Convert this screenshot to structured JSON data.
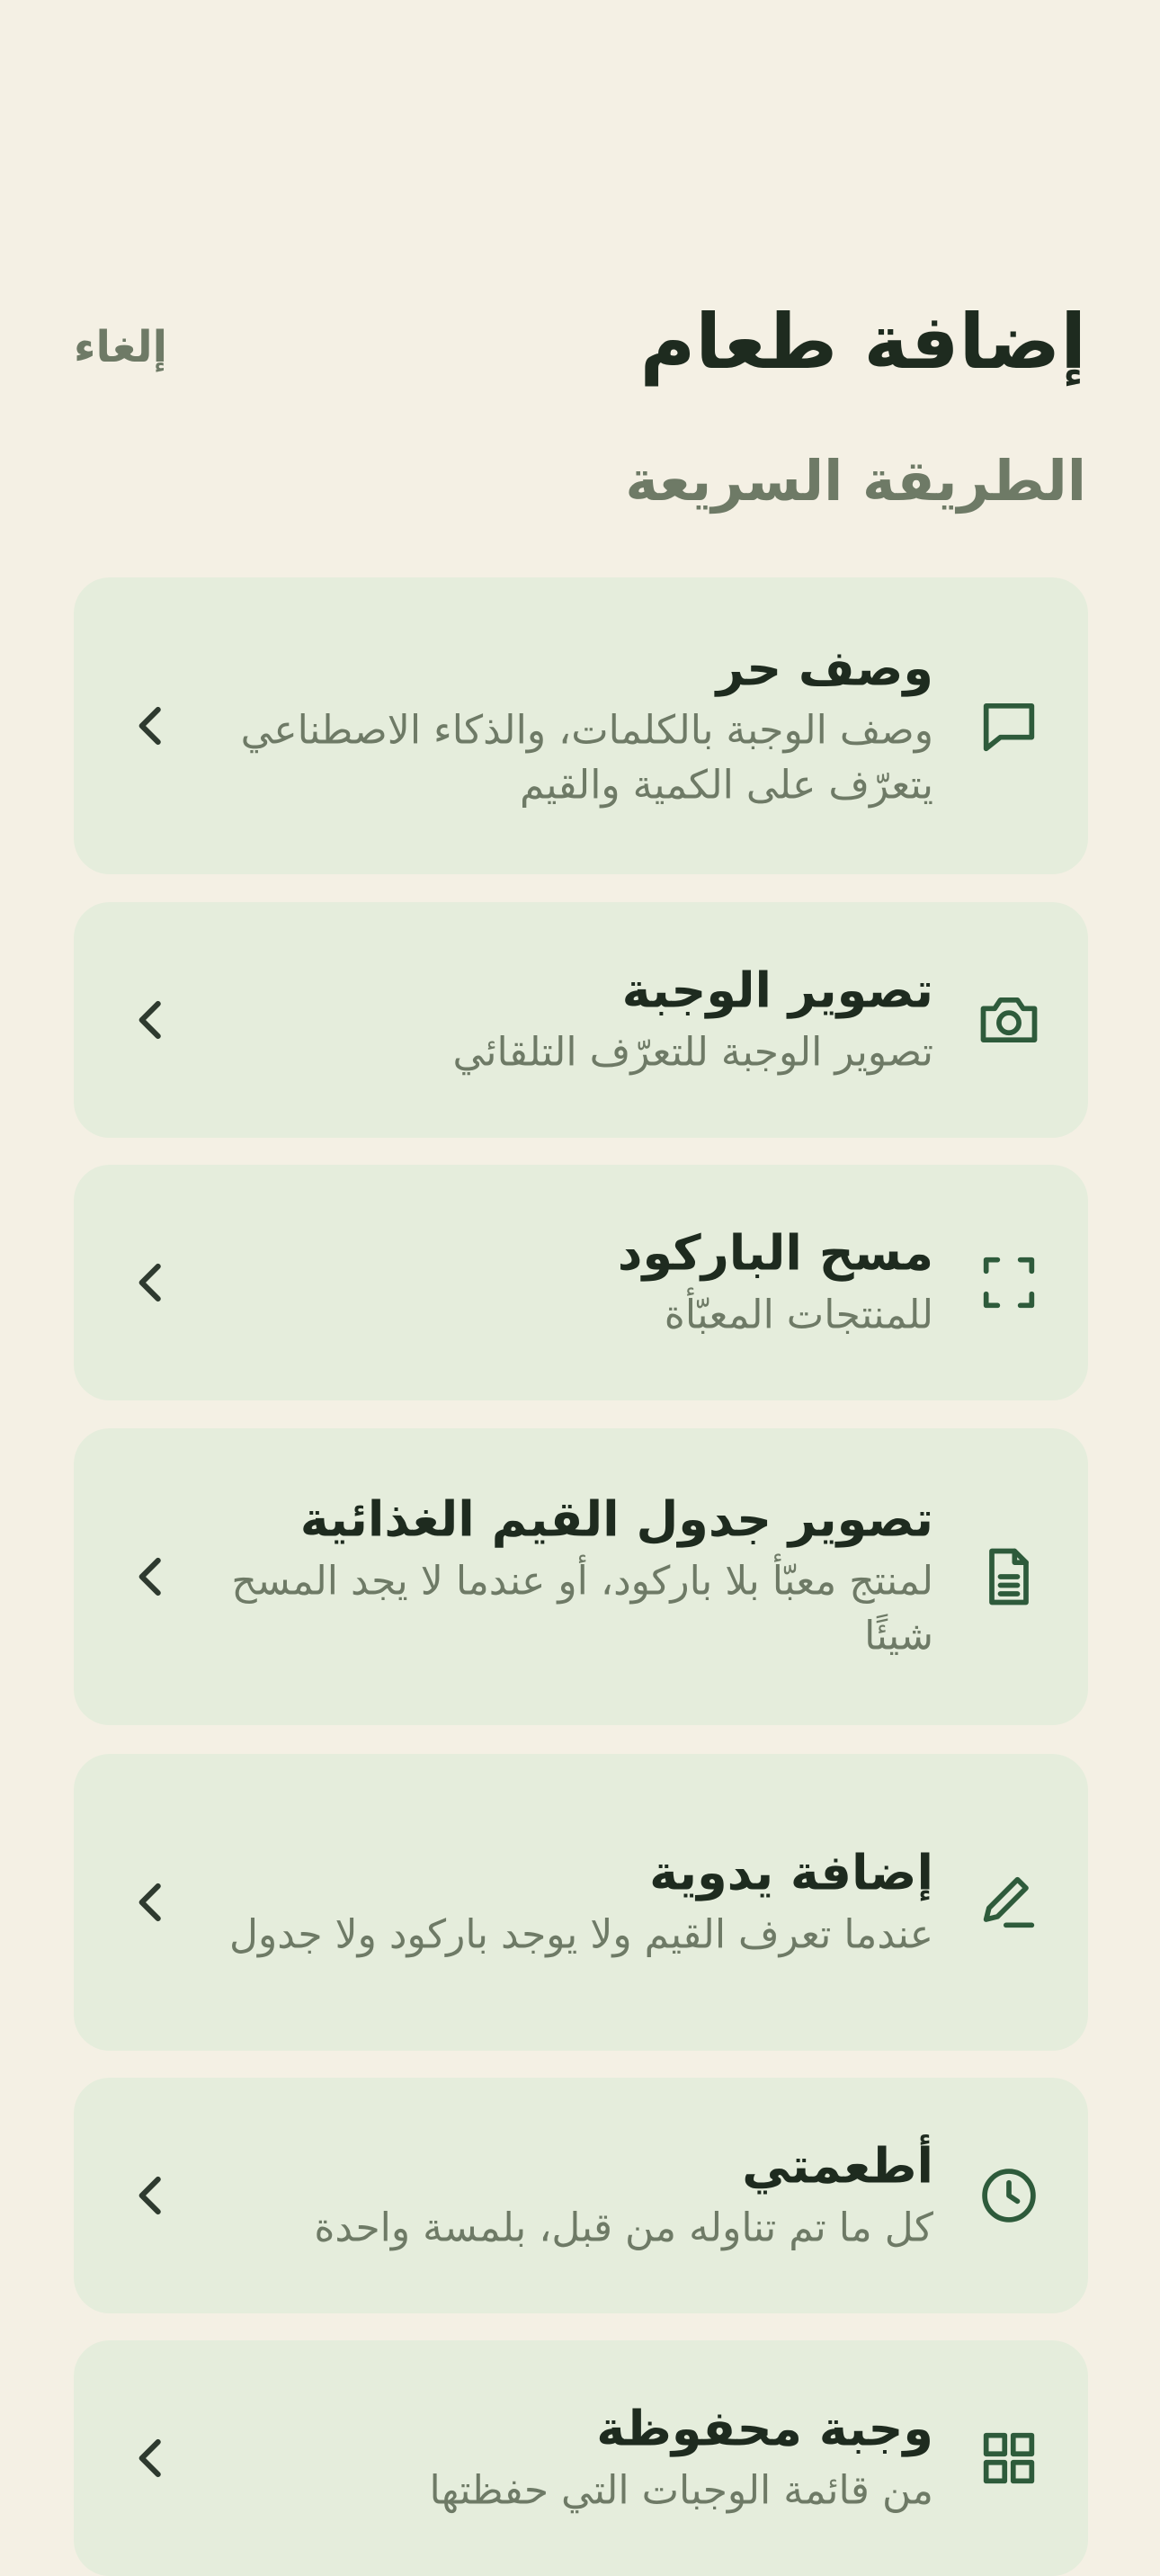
{
  "header": {
    "title": "إضافة طعام",
    "cancel_label": "إلغاء"
  },
  "section_title": "الطريقة السريعة",
  "colors": {
    "background": "#F4F0E4",
    "card": "#E5EDDC",
    "icon": "#2E5B3B",
    "title_text": "#1E2B1F",
    "secondary_text": "#6E7A66"
  },
  "options": [
    {
      "title": "وصف حر",
      "description": "وصف الوجبة بالكلمات، والذكاء الاصطناعي يتعرّف على الكمية والقيم",
      "icon": "chat-bubble-icon"
    },
    {
      "title": "تصوير الوجبة",
      "description": "تصوير الوجبة للتعرّف التلقائي",
      "icon": "camera-icon"
    },
    {
      "title": "مسح الباركود",
      "description": "للمنتجات المعبّأة",
      "icon": "scan-frame-icon"
    },
    {
      "title": "تصوير جدول القيم الغذائية",
      "description": "لمنتج معبّأ بلا باركود، أو عندما لا يجد المسح شيئًا",
      "icon": "document-icon"
    },
    {
      "title": "إضافة يدوية",
      "description": "عندما تعرف القيم ولا يوجد باركود ولا جدول",
      "icon": "pencil-icon"
    },
    {
      "title": "أطعمتي",
      "description": "كل ما تم تناوله من قبل، بلمسة واحدة",
      "icon": "clock-icon"
    },
    {
      "title": "وجبة محفوظة",
      "description": "من قائمة الوجبات التي حفظتها",
      "icon": "grid-icon"
    }
  ]
}
